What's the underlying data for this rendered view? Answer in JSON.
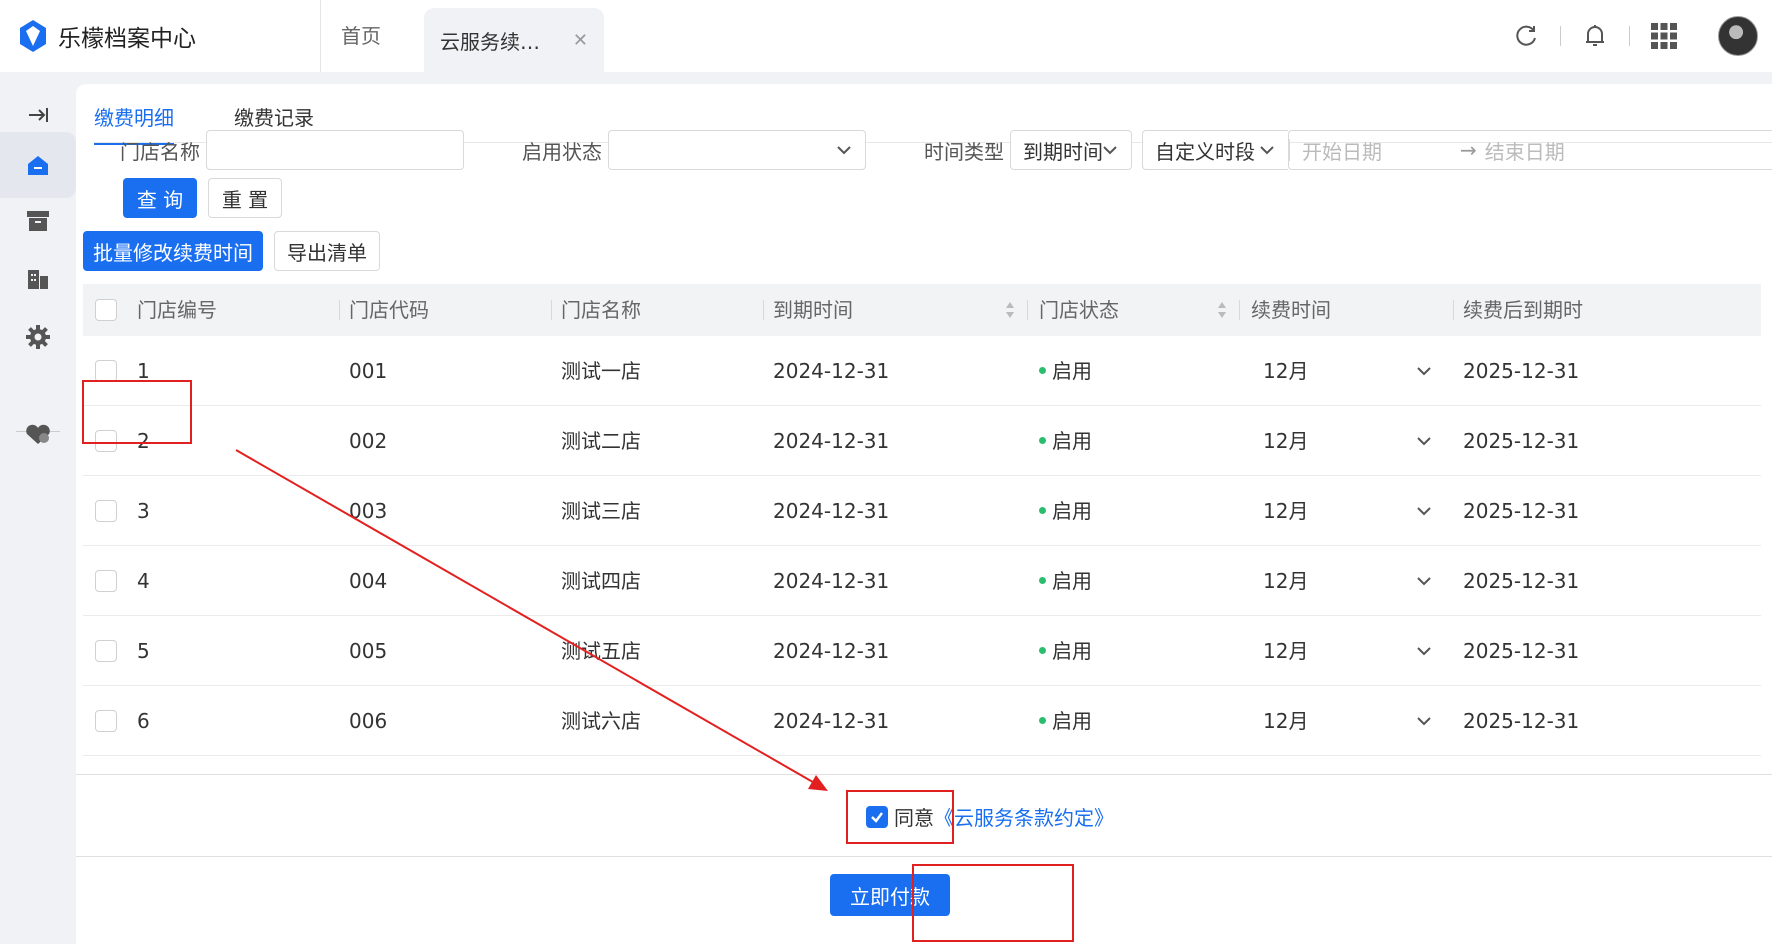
{
  "header": {
    "app_title": "乐檬档案中心",
    "tabs": [
      {
        "label": "首页"
      },
      {
        "label": "云服务续…",
        "closable": true
      }
    ],
    "icons": [
      "refresh-icon",
      "bell-icon",
      "grid-apps-icon",
      "avatar"
    ]
  },
  "sidebar": {
    "items": [
      "collapse-arrow-icon",
      "home-icon",
      "archive-icon",
      "building-icon",
      "gear-icon",
      "heart-tag-icon"
    ],
    "active_index": 1
  },
  "main": {
    "tabs": [
      {
        "label": "缴费明细",
        "active": true
      },
      {
        "label": "缴费记录",
        "active": false
      }
    ],
    "filters": {
      "store_name_label": "门店名称",
      "store_name_value": "",
      "status_label": "启用状态",
      "status_value": "",
      "time_type_label": "时间类型",
      "time_type_value": "到期时间",
      "period_value": "自定义时段",
      "start_placeholder": "开始日期",
      "end_placeholder": "结束日期",
      "range_arrow": "→"
    },
    "buttons": {
      "query": "查 询",
      "reset": "重 置",
      "batch_edit": "批量修改续费时间",
      "export": "导出清单"
    },
    "table": {
      "columns": [
        "门店编号",
        "门店代码",
        "门店名称",
        "到期时间",
        "门店状态",
        "续费时间",
        "续费后到期时"
      ],
      "rows": [
        {
          "no": "1",
          "code": "001",
          "name": "测试一店",
          "expire": "2024-12-31",
          "status": "启用",
          "renew": "12月",
          "after": "2025-12-31"
        },
        {
          "no": "2",
          "code": "002",
          "name": "测试二店",
          "expire": "2024-12-31",
          "status": "启用",
          "renew": "12月",
          "after": "2025-12-31"
        },
        {
          "no": "3",
          "code": "003",
          "name": "测试三店",
          "expire": "2024-12-31",
          "status": "启用",
          "renew": "12月",
          "after": "2025-12-31"
        },
        {
          "no": "4",
          "code": "004",
          "name": "测试四店",
          "expire": "2024-12-31",
          "status": "启用",
          "renew": "12月",
          "after": "2025-12-31"
        },
        {
          "no": "5",
          "code": "005",
          "name": "测试五店",
          "expire": "2024-12-31",
          "status": "启用",
          "renew": "12月",
          "after": "2025-12-31"
        },
        {
          "no": "6",
          "code": "006",
          "name": "测试六店",
          "expire": "2024-12-31",
          "status": "启用",
          "renew": "12月",
          "after": "2025-12-31"
        }
      ]
    },
    "footer": {
      "agree_text": "同意",
      "agree_checked": true,
      "terms_link": "《云服务条款约定》",
      "pay_button": "立即付款"
    }
  },
  "colors": {
    "primary": "#1a6ff0",
    "status_green": "#2bbd6e",
    "annotation_red": "#e32020"
  }
}
